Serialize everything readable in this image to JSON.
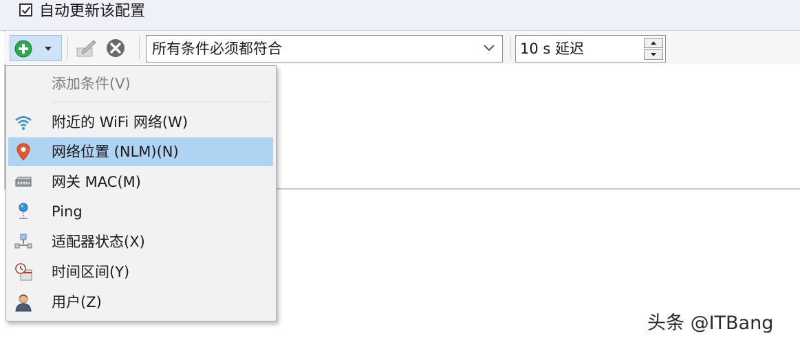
{
  "auto_update": {
    "checked": true,
    "label": "自动更新该配置"
  },
  "toolbar": {
    "match_mode": {
      "value": "所有条件必须都符合"
    },
    "delay": {
      "value": "10 s 延迟"
    }
  },
  "menu": {
    "header": "添加条件(V)",
    "items": [
      {
        "label": "附近的 WiFi 网络(W)",
        "icon": "wifi-icon"
      },
      {
        "label": "网络位置 (NLM)(N)",
        "icon": "location-pin-icon",
        "selected": true
      },
      {
        "label": "网关 MAC(M)",
        "icon": "gateway-icon"
      },
      {
        "label": "Ping",
        "icon": "ping-icon"
      },
      {
        "label": "适配器状态(X)",
        "icon": "adapter-icon"
      },
      {
        "label": "时间区间(Y)",
        "icon": "clock-calendar-icon"
      },
      {
        "label": "用户(Z)",
        "icon": "user-icon"
      }
    ]
  },
  "colors": {
    "selected_bg": "#aed3f3",
    "add_green": "#2fa84f",
    "pin_orange": "#e8562b",
    "wifi_blue": "#3a8fd6"
  },
  "watermark": "头条 @ITBang"
}
